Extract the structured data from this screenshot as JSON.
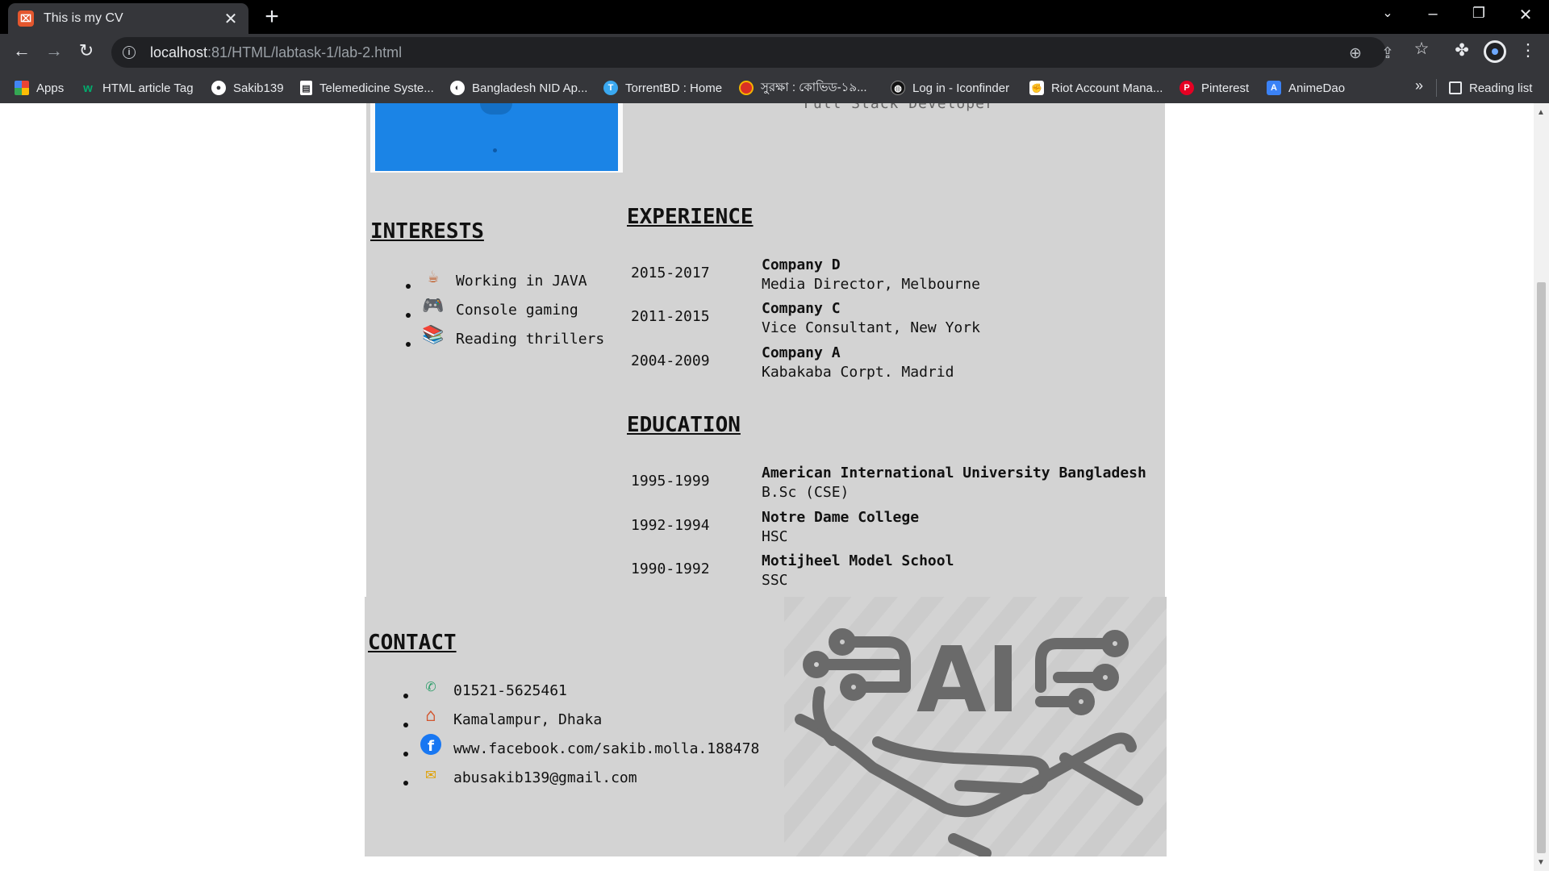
{
  "browser": {
    "tab_title": "This is my CV",
    "tab_favicon_glyph": "⌧",
    "url_host": "localhost",
    "url_rest": ":81/HTML/labtask-1/lab-2.html",
    "bookmarks": [
      {
        "label": "Apps",
        "icon": "apps-grid-icon",
        "color": "#ea4335"
      },
      {
        "label": "HTML article Tag",
        "icon": "w3schools-icon",
        "color": "#04aa6d"
      },
      {
        "label": "Sakib139",
        "icon": "github-icon",
        "color": "#ffffff"
      },
      {
        "label": "Telemedicine Syste...",
        "icon": "document-icon",
        "color": "#ffffff"
      },
      {
        "label": "Bangladesh NID Ap...",
        "icon": "globe-icon",
        "color": "#ffffff"
      },
      {
        "label": "TorrentBD : Home",
        "icon": "torrentbd-icon",
        "color": "#3aa8f0"
      },
      {
        "label": "সুরক্ষা : কোভিড-১৯...",
        "icon": "bd-govt-icon",
        "color": "#d93025"
      },
      {
        "label": "Log in - Iconfinder",
        "icon": "iconfinder-icon",
        "color": "#111111"
      },
      {
        "label": "Riot Account Mana...",
        "icon": "riot-icon",
        "color": "#ffffff"
      },
      {
        "label": "Pinterest",
        "icon": "pinterest-icon",
        "color": "#e60023"
      },
      {
        "label": "AnimeDao",
        "icon": "animedao-icon",
        "color": "#3b82f6"
      }
    ],
    "reading_list": "Reading list"
  },
  "cv": {
    "role_fragment": "Full Stack Developer",
    "interests": {
      "heading": "INTERESTS",
      "items": [
        {
          "label": "Working in JAVA",
          "icon": "java-cup-icon"
        },
        {
          "label": "Console gaming",
          "icon": "gamepad-icon"
        },
        {
          "label": "Reading thrillers",
          "icon": "books-icon"
        }
      ]
    },
    "experience": {
      "heading": "EXPERIENCE",
      "entries": [
        {
          "years": "2015-2017",
          "org": "Company D",
          "role": "Media Director, Melbourne"
        },
        {
          "years": "2011-2015",
          "org": "Company C",
          "role": "Vice Consultant, New York"
        },
        {
          "years": "2004-2009",
          "org": "Company A",
          "role": "Kabakaba Corpt. Madrid"
        }
      ]
    },
    "education": {
      "heading": "EDUCATION",
      "entries": [
        {
          "years": "1995-1999",
          "org": "American International University Bangladesh",
          "role": "B.Sc (CSE)"
        },
        {
          "years": "1992-1994",
          "org": "Notre Dame College",
          "role": "HSC"
        },
        {
          "years": "1990-1992",
          "org": "Motijheel Model School",
          "role": "SSC"
        }
      ]
    },
    "contact": {
      "heading": "CONTACT",
      "items": [
        {
          "label": "01521-5625461",
          "icon": "phone-icon"
        },
        {
          "label": "Kamalampur, Dhaka",
          "icon": "home-icon"
        },
        {
          "label": "www.facebook.com/sakib.molla.188478",
          "icon": "facebook-icon"
        },
        {
          "label": "abusakib139@gmail.com",
          "icon": "mail-icon"
        }
      ],
      "art_text": "AI"
    }
  }
}
